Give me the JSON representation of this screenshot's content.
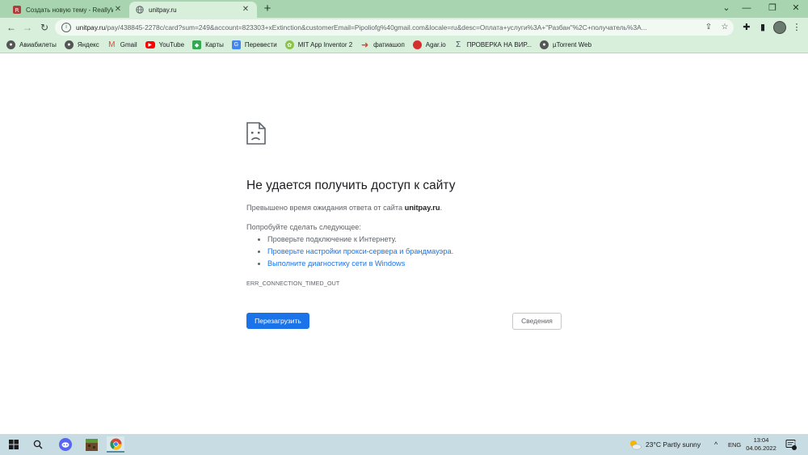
{
  "browser": {
    "tabs": [
      {
        "title": "Создать новую тему - ReallyWo...",
        "active": false
      },
      {
        "title": "unitpay.ru",
        "active": true
      }
    ],
    "url_domain": "unitpay.ru",
    "url_rest": "/pay/438845-2278c/card?sum=249&account=823303+xExtinction&customerEmail=Pipoliofg%40gmail.com&locale=ru&desc=Оплата+услуги%3A+\"Разбан\"%2C+получатель%3A...",
    "bookmarks": [
      {
        "label": "Авиабилеты",
        "icon": "globe-icon",
        "color": "#555555"
      },
      {
        "label": "Яндекс",
        "icon": "globe-icon",
        "color": "#555555"
      },
      {
        "label": "Gmail",
        "icon": "gmail-icon",
        "color": "#ea4335"
      },
      {
        "label": "YouTube",
        "icon": "youtube-icon",
        "color": "#ff0000"
      },
      {
        "label": "Карты",
        "icon": "maps-icon",
        "color": "#34a853"
      },
      {
        "label": "Перевести",
        "icon": "translate-icon",
        "color": "#4285f4"
      },
      {
        "label": "MIT App Inventor 2",
        "icon": "app-inventor-icon",
        "color": "#8bc34a"
      },
      {
        "label": "фатиашоп",
        "icon": "arrow-icon",
        "color": "#e53935"
      },
      {
        "label": "Agar.io",
        "icon": "agar-icon",
        "color": "#d32f2f"
      },
      {
        "label": "ПРОВЕРКА НА ВИР...",
        "icon": "virustotal-icon",
        "color": "#3949ab"
      },
      {
        "label": "µTorrent Web",
        "icon": "globe-icon",
        "color": "#555555"
      }
    ]
  },
  "error": {
    "title": "Не удается получить доступ к сайту",
    "message_prefix": "Превышено время ожидания ответа от сайта ",
    "message_domain": "unitpay.ru",
    "message_suffix": ".",
    "try_heading": "Попробуйте сделать следующее:",
    "suggestion_1": "Проверьте подключение к Интернету.",
    "suggestion_2": "Проверьте настройки прокси-сервера и брандмауэра.",
    "suggestion_3": "Выполните диагностику сети в Windows",
    "code": "ERR_CONNECTION_TIMED_OUT",
    "reload_label": "Перезагрузить",
    "details_label": "Сведения"
  },
  "taskbar": {
    "weather_temp": "23°C",
    "weather_desc": "Partly sunny",
    "lang": "ENG",
    "time": "13:04",
    "date": "04.06.2022",
    "notification_count": "3"
  },
  "colors": {
    "accent": "#1a73e8",
    "tab_strip": "#a8d5b0",
    "toolbar": "#d7efdb",
    "taskbar": "#c8dce3"
  }
}
